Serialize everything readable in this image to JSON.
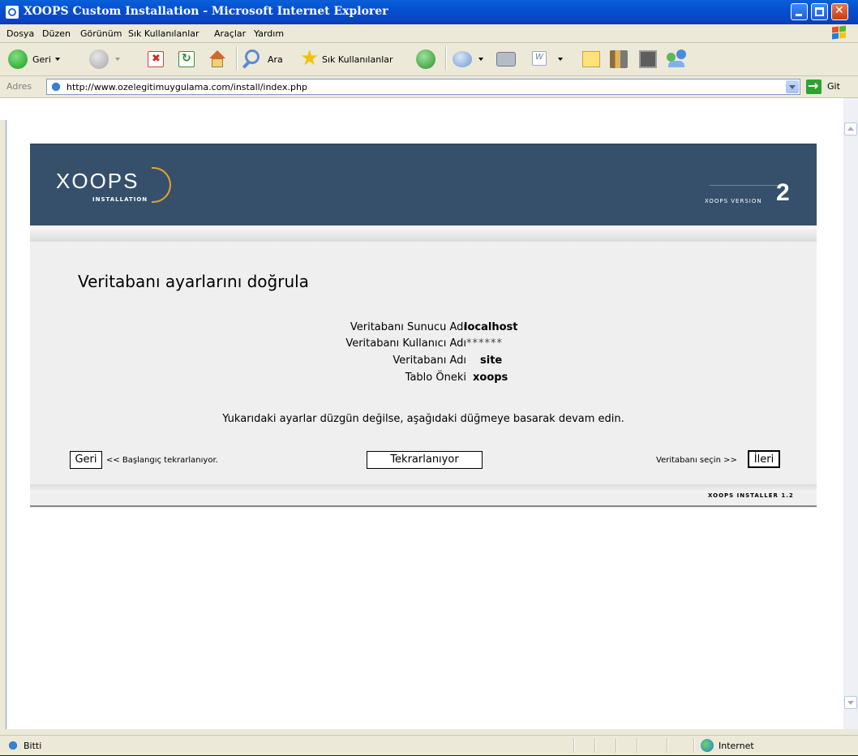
{
  "window": {
    "title": "XOOPS Custom Installation - Microsoft Internet Explorer"
  },
  "menu": {
    "items": [
      "Dosya",
      "Düzen",
      "Görünüm",
      "Sık Kullanılanlar",
      "Araçlar",
      "Yardım"
    ]
  },
  "toolbar": {
    "back_label": "Geri",
    "search_label": "Ara",
    "favorites_label": "Sık Kullanılanlar"
  },
  "address": {
    "label": "Adres",
    "url": "http://www.ozelegitimuygulama.com/install/index.php",
    "go_label": "Git"
  },
  "installer": {
    "logo_text": "XOOPS",
    "logo_sub": "INSTALLATION",
    "version_text": "XOOPS VERSION",
    "version_number": "2",
    "page_title": "Veritabanı ayarlarını doğrula",
    "settings": [
      {
        "label": "Veritabanı Sunucu Adı",
        "value": "localhost"
      },
      {
        "label": "Veritabanı Kullanıcı Adı",
        "value": "******"
      },
      {
        "label": "Veritabanı Adı",
        "value": "site"
      },
      {
        "label": "Tablo Öneki",
        "value": "xoops"
      }
    ],
    "note": "Yukarıdaki ayarlar düzgün değilse, aşağıdaki düğmeye basarak devam edin.",
    "back_button": "Geri",
    "back_text": "<< Başlangıç tekrarlanıyor.",
    "reload_button": "Tekrarlanıyor",
    "next_text": "Veritabanı seçin >>",
    "next_button": "İleri",
    "footer": "XOOPS INSTALLER 1.2"
  },
  "status": {
    "text": "Bitti",
    "zone": "Internet"
  },
  "colors": {
    "titlebar": "#0550d0",
    "header": "#36506b",
    "accent_arc": "#e5a329"
  }
}
